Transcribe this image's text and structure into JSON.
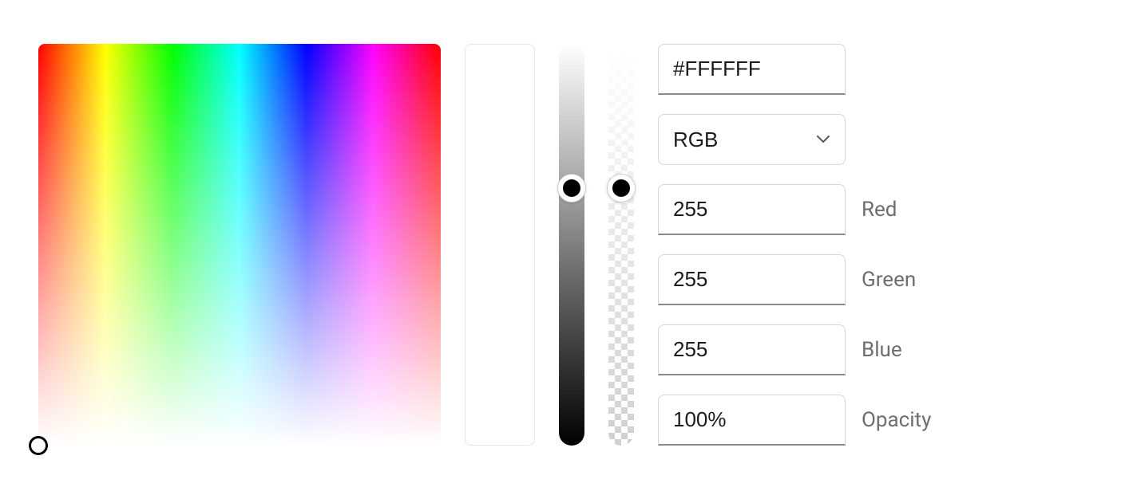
{
  "hex": "#FFFFFF",
  "modeSelect": {
    "selected": "RGB"
  },
  "channels": {
    "red": {
      "label": "Red",
      "value": "255"
    },
    "green": {
      "label": "Green",
      "value": "255"
    },
    "blue": {
      "label": "Blue",
      "value": "255"
    }
  },
  "opacity": {
    "label": "Opacity",
    "value": "100%"
  }
}
